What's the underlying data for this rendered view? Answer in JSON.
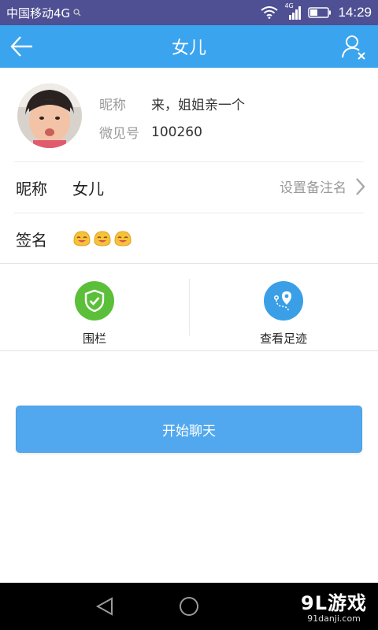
{
  "status_bar": {
    "carrier": "中国移动4G",
    "network_badge": "4G",
    "time": "14:29"
  },
  "header": {
    "title": "女儿"
  },
  "profile": {
    "nickname_label": "昵称",
    "nickname_value": "来，姐姐亲一个",
    "id_label": "微见号",
    "id_value": "100260"
  },
  "info": {
    "nickname_label": "昵称",
    "nickname_value": "女儿",
    "remark_label": "设置备注名",
    "signature_label": "签名"
  },
  "actions": [
    {
      "label": "围栏",
      "icon": "shield-check-icon",
      "color": "#5bbf3a"
    },
    {
      "label": "查看足迹",
      "icon": "location-route-icon",
      "color": "#3a9fe6"
    }
  ],
  "chat_button": {
    "label": "开始聊天"
  },
  "watermark": {
    "main": "9L游戏",
    "sub": "91danji.com"
  },
  "colors": {
    "header": "#3aa4ee",
    "button": "#52a8ee",
    "status_bar": "#4f4f93"
  }
}
